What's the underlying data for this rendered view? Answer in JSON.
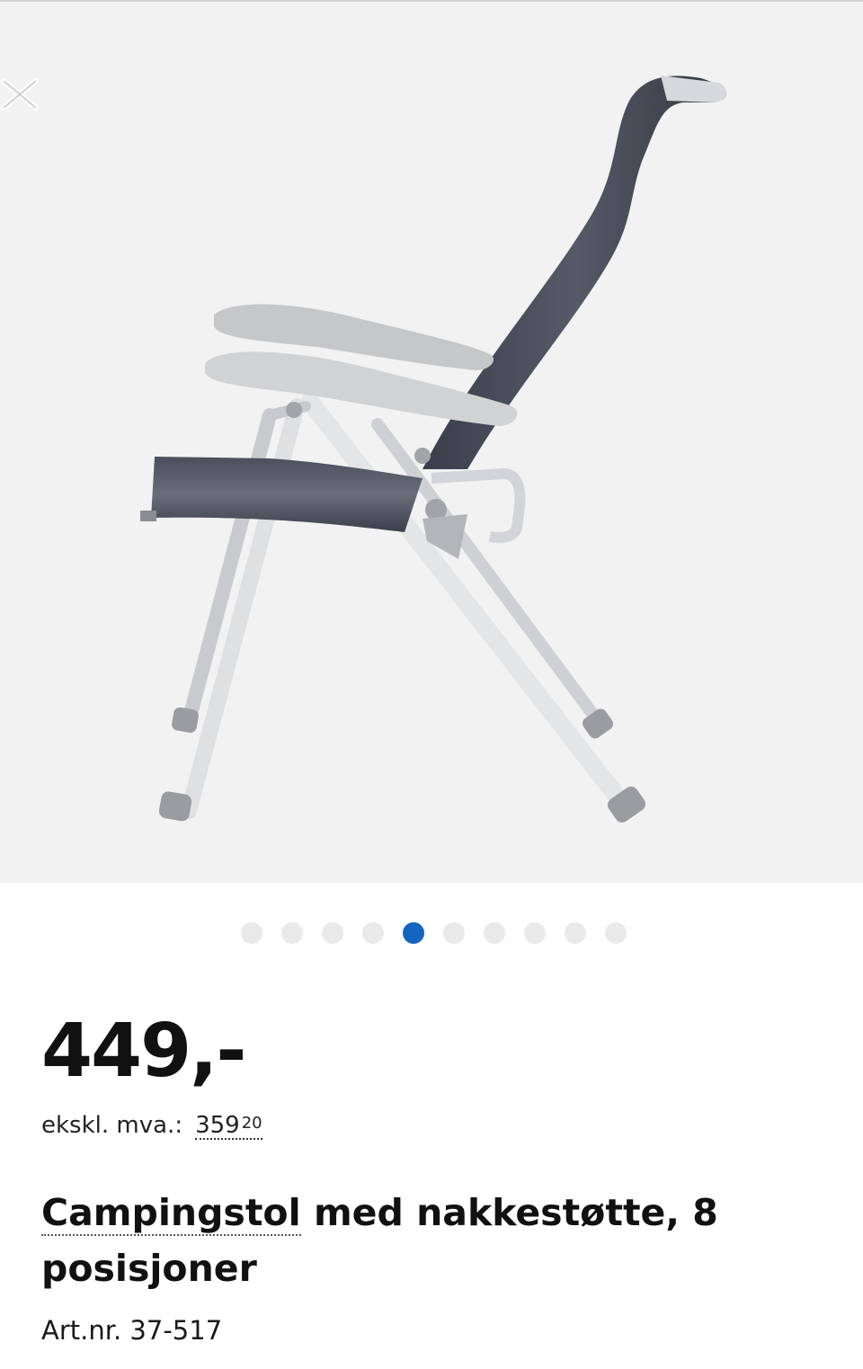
{
  "gallery": {
    "image_alt": "Campingstol med nakkestøtte, 8 posisjoner",
    "close_icon": "close-icon",
    "dot_count": 10,
    "active_index": 4,
    "colors": {
      "active_dot": "#1565c0",
      "inactive_dot": "#e9e9ea",
      "background": "#f2f2f3"
    }
  },
  "product": {
    "price": "449,-",
    "ex_vat_label": "ekskl. mva.:",
    "ex_vat_main": "359",
    "ex_vat_cents": "20",
    "title_first_word": "Campingstol",
    "title_rest": "med nakkestøtte, 8 posisjoner",
    "article_number": "Art.nr. 37-517"
  }
}
